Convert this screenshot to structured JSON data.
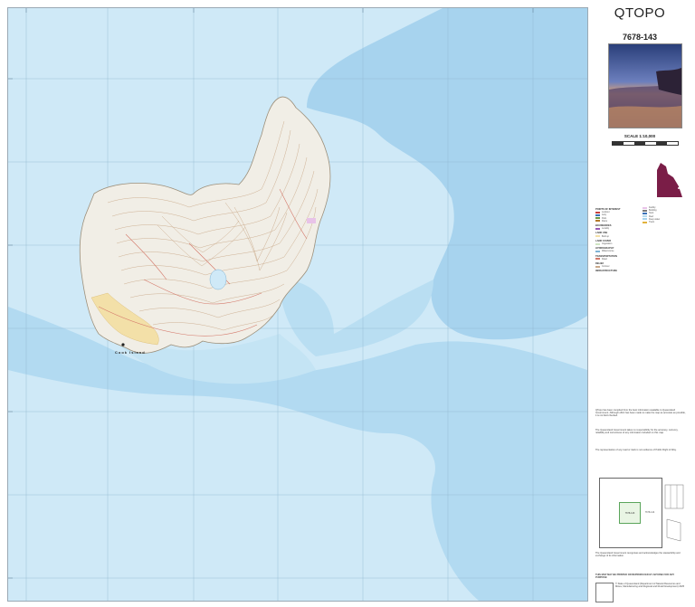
{
  "panel": {
    "title": "QTOPO",
    "map_number": "7678-143",
    "scale": "SCALE 1:10,000"
  },
  "map": {
    "island_label": "Cook Island",
    "water_color": "#cfe9f7",
    "deep_water_color": "#a7d3ee",
    "land_color": "#f1eee6",
    "contour_color": "#c9a98a",
    "road_color": "#d4786a",
    "reef_color": "#b6dcef",
    "grid_color": "#8fb6cf",
    "town_color": "#f3e0a8"
  },
  "legend": {
    "heading_poi": "POINTS OF INTEREST",
    "heading_boundaries": "BOUNDARIES",
    "heading_land_use": "LAND USE",
    "heading_land_cover": "LAND COVER",
    "heading_hydrography": "HYDROGRAPHY",
    "heading_transportation": "TRANSPORTATION",
    "heading_relief": "RELIEF",
    "heading_infrastructure": "INFRASTRUCTURE"
  },
  "disclaimer": {
    "p1": "QTopo has been compiled from the best information available to Queensland Government. Although effort has been made to make the map as accurate as possible, it is not field checked.",
    "p2": "The Queensland Government takes no responsibility for the accuracy, currency, reliability and correctness of any information included on this map.",
    "p3": "The representation of any road or track is not evidence of Public Right of Way.",
    "p4": "The Queensland Government recognises and acknowledges the stewardship and exchange of its information.",
    "p5": "THIS MAP MAY BE PRINTED OR REPRODUCED BY ANYONE FOR ANY PURPOSE",
    "copyright": "© State of Queensland (Department of Natural Resources and Mines, Manufacturing and Regional and Rural Development) 2025"
  },
  "index": {
    "current_sheet": "7678-143",
    "adjacent_sheet": "7678-144"
  }
}
